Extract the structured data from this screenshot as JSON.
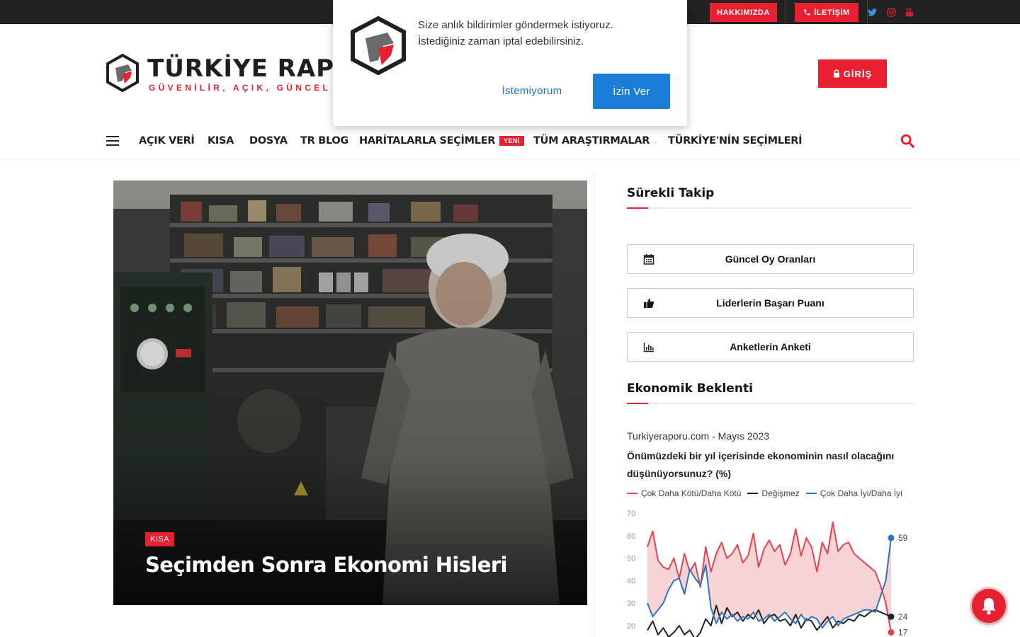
{
  "topbar": {
    "about_label": "HAKKIMIZDA",
    "contact_label": "İLETİŞİM",
    "social": [
      "twitter-icon",
      "instagram-icon",
      "youtube-icon"
    ]
  },
  "brand": {
    "title": "TÜRKİYE RAPOR",
    "tagline": "GÜVENİLİR, AÇIK, GÜNCEL VE",
    "accent": "#e8202f"
  },
  "header": {
    "login_label": "GİRİŞ"
  },
  "nav": {
    "items": [
      {
        "label": "AÇIK VERİ"
      },
      {
        "label": "KISA"
      },
      {
        "label": "DOSYA"
      },
      {
        "label": "TR BLOG"
      },
      {
        "label": "HARİTALARLA SEÇİMLER",
        "badge": "YENİ"
      },
      {
        "label": "TÜM ARAŞTIRMALAR"
      },
      {
        "label": "TÜRKİYE'NİN SEÇİMLERİ"
      }
    ]
  },
  "hero": {
    "category": "KISA",
    "title": "Seçimden Sonra Ekonomi Hisleri"
  },
  "sidebar": {
    "tracking_title": "Sürekli Takip",
    "buttons": [
      {
        "label": "Güncel Oy Oranları",
        "icon": "calendar-icon"
      },
      {
        "label": "Liderlerin Başarı Puanı",
        "icon": "thumbs-up-icon"
      },
      {
        "label": "Anketlerin Anketi",
        "icon": "bar-chart-icon"
      }
    ],
    "economic_title": "Ekonomik Beklenti"
  },
  "chart_data": {
    "type": "line",
    "source": "Turkiyeraporu.com - Mayıs 2023",
    "title": "Önümüzdeki bir yıl içerisinde ekonominin nasıl olacağını düşünüyorsunuz? (%)",
    "yticks": [
      70,
      60,
      50,
      40,
      30,
      20
    ],
    "ylim": [
      17,
      70
    ],
    "series": [
      {
        "name": "Çok Daha Kötü/Daha Kötü",
        "color": "#e8414f",
        "values": [
          55,
          62,
          49,
          46,
          45,
          50,
          41,
          52,
          44,
          48,
          37,
          55,
          44,
          52,
          57,
          50,
          52,
          56,
          48,
          51,
          61,
          46,
          54,
          58,
          53,
          56,
          47,
          52,
          63,
          51,
          59,
          55,
          44,
          57,
          52,
          66,
          53,
          56,
          57,
          52,
          50,
          48,
          46,
          44,
          38,
          30,
          17
        ]
      },
      {
        "name": "Değişmez",
        "color": "#222222",
        "values": [
          18,
          22,
          16,
          19,
          15,
          17,
          20,
          16,
          18,
          14,
          17,
          23,
          20,
          29,
          21,
          28,
          24,
          26,
          22,
          25,
          23,
          27,
          21,
          24,
          25,
          22,
          23,
          20,
          25,
          19,
          23,
          22,
          18,
          21,
          24,
          19,
          22,
          21,
          23,
          22,
          25,
          24,
          26,
          27,
          26,
          25,
          24
        ]
      },
      {
        "name": "Çok Daha İyi/Daha İyi",
        "color": "#2e74c0",
        "values": [
          30,
          24,
          27,
          30,
          36,
          40,
          41,
          34,
          45,
          41,
          38,
          47,
          28,
          21,
          26,
          23,
          25,
          22,
          24,
          23,
          26,
          22,
          23,
          25,
          22,
          24,
          26,
          23,
          21,
          25,
          22,
          24,
          23,
          19,
          22,
          24,
          20,
          23,
          24,
          25,
          26,
          27,
          27,
          26,
          33,
          40,
          59
        ]
      }
    ],
    "end_labels": [
      "59",
      "24",
      "17"
    ]
  },
  "popup": {
    "message_line1": "Size anlık bildirimler göndermek istiyoruz.",
    "message_line2": "İstediğiniz zaman iptal edebilirsiniz.",
    "deny_label": "İstemiyorum",
    "allow_label": "İzin Ver"
  }
}
